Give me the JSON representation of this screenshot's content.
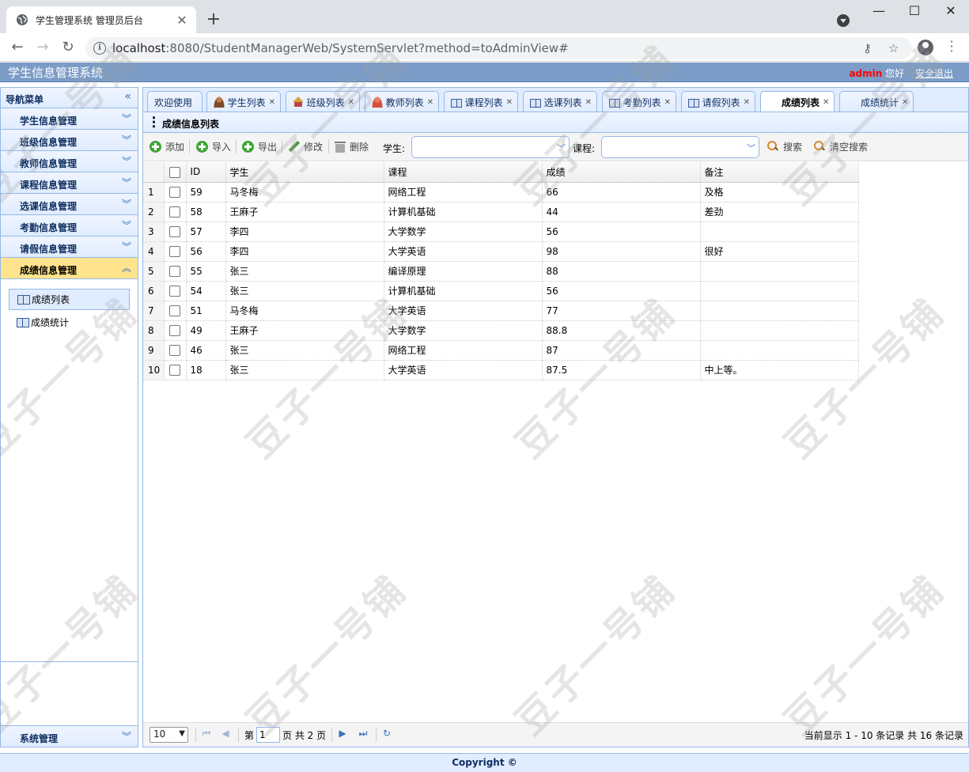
{
  "browser": {
    "tab_title": "学生管理系统 管理员后台",
    "url_host": "localhost",
    "url_path": ":8080/StudentManagerWeb/SystemServlet?method=toAdminView#"
  },
  "app": {
    "title": "学生信息管理系统",
    "user": "admin",
    "greeting": "您好",
    "logout": "安全退出"
  },
  "nav": {
    "header": "导航菜单",
    "sections": [
      {
        "label": "学生信息管理"
      },
      {
        "label": "班级信息管理"
      },
      {
        "label": "教师信息管理"
      },
      {
        "label": "课程信息管理"
      },
      {
        "label": "选课信息管理"
      },
      {
        "label": "考勤信息管理"
      },
      {
        "label": "请假信息管理"
      },
      {
        "label": "成绩信息管理"
      }
    ],
    "active_section_items": [
      {
        "label": "成绩列表"
      },
      {
        "label": "成绩统计"
      }
    ],
    "system": "系统管理"
  },
  "tabs": [
    {
      "label": "欢迎使用",
      "icon": "none"
    },
    {
      "label": "学生列表",
      "icon": "student-icon"
    },
    {
      "label": "班级列表",
      "icon": "home-icon"
    },
    {
      "label": "教师列表",
      "icon": "teacher-icon"
    },
    {
      "label": "课程列表",
      "icon": "book-icon"
    },
    {
      "label": "选课列表",
      "icon": "book-icon"
    },
    {
      "label": "考勤列表",
      "icon": "book-icon"
    },
    {
      "label": "请假列表",
      "icon": "book-icon"
    },
    {
      "label": "成绩列表",
      "icon": "none"
    },
    {
      "label": "成绩统计",
      "icon": "none"
    }
  ],
  "panel": {
    "title": "成绩信息列表"
  },
  "toolbar": {
    "add": "添加",
    "import": "导入",
    "export": "导出",
    "edit": "修改",
    "delete": "删除",
    "student_label": "学生:",
    "course_label": "课程:",
    "search": "搜索",
    "clear": "清空搜索"
  },
  "grid": {
    "columns": [
      "ID",
      "学生",
      "课程",
      "成绩",
      "备注"
    ],
    "rows": [
      {
        "n": "1",
        "id": "59",
        "student": "马冬梅",
        "course": "网络工程",
        "score": "66",
        "remark": "及格"
      },
      {
        "n": "2",
        "id": "58",
        "student": "王麻子",
        "course": "计算机基础",
        "score": "44",
        "remark": "差劲"
      },
      {
        "n": "3",
        "id": "57",
        "student": "李四",
        "course": "大学数学",
        "score": "56",
        "remark": ""
      },
      {
        "n": "4",
        "id": "56",
        "student": "李四",
        "course": "大学英语",
        "score": "98",
        "remark": "很好"
      },
      {
        "n": "5",
        "id": "55",
        "student": "张三",
        "course": "编译原理",
        "score": "88",
        "remark": ""
      },
      {
        "n": "6",
        "id": "54",
        "student": "张三",
        "course": "计算机基础",
        "score": "56",
        "remark": ""
      },
      {
        "n": "7",
        "id": "51",
        "student": "马冬梅",
        "course": "大学英语",
        "score": "77",
        "remark": ""
      },
      {
        "n": "8",
        "id": "49",
        "student": "王麻子",
        "course": "大学数学",
        "score": "88.8",
        "remark": ""
      },
      {
        "n": "9",
        "id": "46",
        "student": "张三",
        "course": "网络工程",
        "score": "87",
        "remark": ""
      },
      {
        "n": "10",
        "id": "18",
        "student": "张三",
        "course": "大学英语",
        "score": "87.5",
        "remark": "中上等。"
      }
    ]
  },
  "pager": {
    "page_size": "10",
    "page_prefix": "第",
    "current_page": "1",
    "page_suffix": "页 共 2 页",
    "summary": "当前显示 1 - 10 条记录 共 16 条记录"
  },
  "footer": "Copyright ©",
  "watermark": "豆子一号铺",
  "colors": {
    "header_bg": "#7b9cc7",
    "panel_border": "#95b8e7",
    "active_section": "#ffe48d",
    "user_name": "#ff0000"
  }
}
